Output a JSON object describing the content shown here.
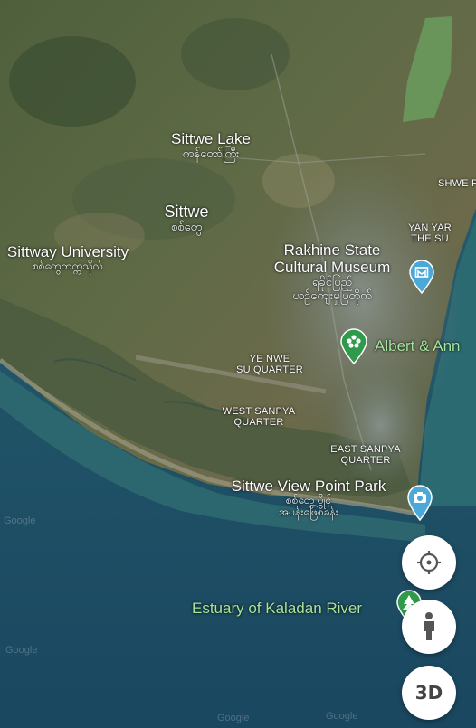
{
  "labels": {
    "sittwe_lake": {
      "en": "Sittwe Lake",
      "mm": "ကန်တော်ကြီး"
    },
    "sittwe": {
      "en": "Sittwe",
      "mm": "စစ်တွေ"
    },
    "university": {
      "en": "Sittway University",
      "mm": "စစ်တွေတက္ကသိုလ်"
    },
    "museum": {
      "en_line1": "Rakhine State",
      "en_line2": "Cultural Museum",
      "mm_line1": "ရခိုင်ပြည်",
      "mm_line2": "ယဉ်ကျေးမှုပြတိုက်"
    },
    "albert": {
      "en": "Albert & Ann"
    },
    "ye_nwe": {
      "line1": "YE NWE",
      "line2": "SU QUARTER"
    },
    "west_sanpya": {
      "line1": "WEST SANPYA",
      "line2": "QUARTER"
    },
    "east_sanpya": {
      "line1": "EAST SANPYA",
      "line2": "QUARTER"
    },
    "view_point": {
      "en": "Sittwe View Point Park",
      "mm_line1": "စစ်တွေ ပွိုင့်",
      "mm_line2": "အပန်းဖြေစခန်း"
    },
    "estuary": {
      "en": "Estuary of Kaladan River"
    },
    "shwe_pi": {
      "en": "SHWE PI"
    },
    "yan_yar": {
      "line1": "YAN YAR",
      "line2": "THE SU"
    }
  },
  "controls": {
    "threed_label": "3D"
  },
  "watermarks": {
    "google_1": "Google",
    "google_2": "Google",
    "google_3": "Google",
    "google_4": "Google"
  },
  "colors": {
    "water_deep": "#1d4d63",
    "water_shallow": "#2f6f78",
    "land_dark": "#3e5a3b",
    "land_light": "#7b7a55",
    "city": "#6f7a78",
    "pin_blue": "#4aa9d9",
    "pin_green": "#2f9a4a"
  }
}
